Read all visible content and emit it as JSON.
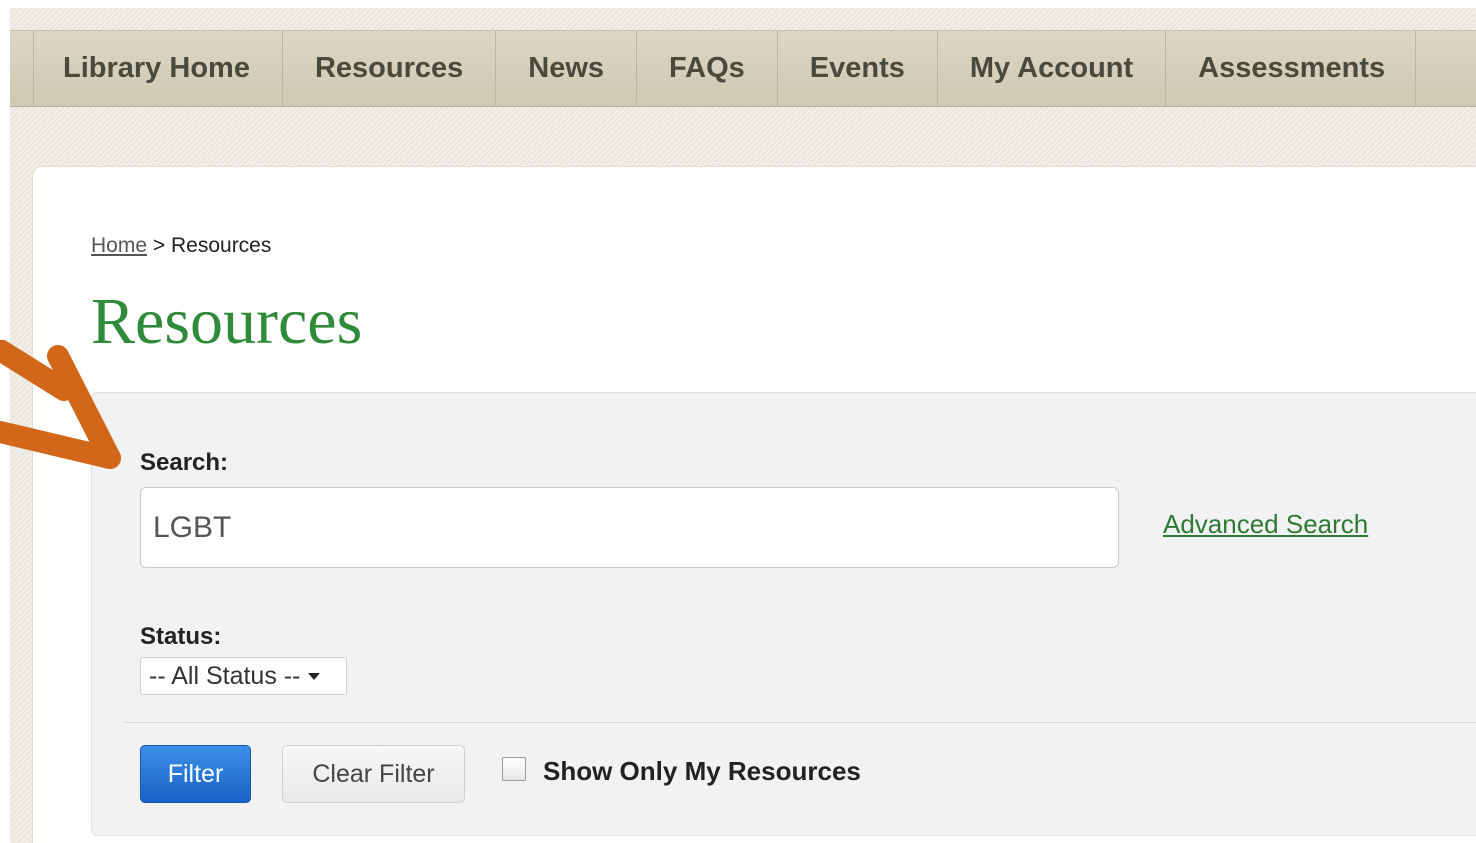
{
  "nav": {
    "items": [
      {
        "label": "Library Home"
      },
      {
        "label": "Resources"
      },
      {
        "label": "News"
      },
      {
        "label": "FAQs"
      },
      {
        "label": "Events"
      },
      {
        "label": "My Account"
      },
      {
        "label": "Assessments"
      }
    ]
  },
  "breadcrumb": {
    "home": "Home",
    "separator": ">",
    "current": "Resources"
  },
  "page": {
    "title": "Resources"
  },
  "filters": {
    "search_label": "Search:",
    "search_value": "LGBT",
    "advanced_search": "Advanced Search",
    "status_label": "Status:",
    "status_selected": "-- All Status --",
    "filter_button": "Filter",
    "clear_button": "Clear Filter",
    "show_mine_label": "Show Only My Resources",
    "show_mine_checked": false
  },
  "colors": {
    "title_green": "#2f8a3a",
    "link_green": "#2e7a34",
    "primary_blue": "#1a63c8",
    "arrow_orange": "#d2671a"
  },
  "icons": {
    "annotation": "orange-arrow-icon",
    "dropdown": "caret-down-icon",
    "checkbox": "checkbox-icon"
  }
}
